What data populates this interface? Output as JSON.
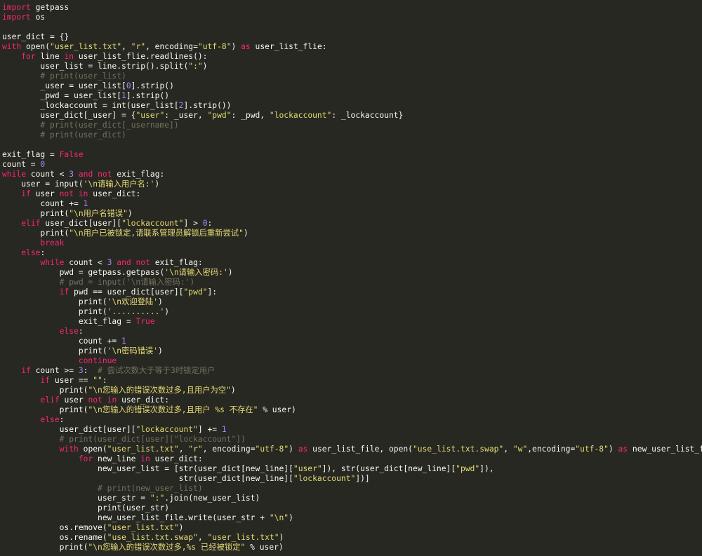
{
  "colors": {
    "background": "#272822",
    "plain": "#f8f8f2",
    "keyword": "#f92672",
    "string": "#e6db74",
    "number": "#ae81ff",
    "comment": "#75715e"
  },
  "editor": {
    "language": "python",
    "lines": [
      [
        [
          "k",
          "import"
        ],
        [
          "p",
          " getpass"
        ]
      ],
      [
        [
          "k",
          "import"
        ],
        [
          "p",
          " os"
        ]
      ],
      [],
      [
        [
          "p",
          "user_dict = {}"
        ]
      ],
      [
        [
          "k",
          "with"
        ],
        [
          "p",
          " open("
        ],
        [
          "s",
          "\"user_list.txt\""
        ],
        [
          "p",
          ", "
        ],
        [
          "s",
          "\"r\""
        ],
        [
          "p",
          ", encoding="
        ],
        [
          "s",
          "\"utf-8\""
        ],
        [
          "p",
          ") "
        ],
        [
          "k",
          "as"
        ],
        [
          "p",
          " user_list_flie:"
        ]
      ],
      [
        [
          "p",
          "    "
        ],
        [
          "k",
          "for"
        ],
        [
          "p",
          " line "
        ],
        [
          "k",
          "in"
        ],
        [
          "p",
          " user_list_flie.readlines():"
        ]
      ],
      [
        [
          "p",
          "        user_list = line.strip().split("
        ],
        [
          "s",
          "\":\""
        ],
        [
          "p",
          ")"
        ]
      ],
      [
        [
          "c",
          "        # print(user_list)"
        ]
      ],
      [
        [
          "p",
          "        _user = user_list["
        ],
        [
          "n",
          "0"
        ],
        [
          "p",
          "].strip()"
        ]
      ],
      [
        [
          "p",
          "        _pwd = user_list["
        ],
        [
          "n",
          "1"
        ],
        [
          "p",
          "].strip()"
        ]
      ],
      [
        [
          "p",
          "        _lockaccount = int(user_list["
        ],
        [
          "n",
          "2"
        ],
        [
          "p",
          "].strip())"
        ]
      ],
      [
        [
          "p",
          "        user_dict[_user] = {"
        ],
        [
          "s",
          "\"user\""
        ],
        [
          "p",
          ": _user, "
        ],
        [
          "s",
          "\"pwd\""
        ],
        [
          "p",
          ": _pwd, "
        ],
        [
          "s",
          "\"lockaccount\""
        ],
        [
          "p",
          ": _lockaccount}"
        ]
      ],
      [
        [
          "c",
          "        # print(user_dict[_username])"
        ]
      ],
      [
        [
          "c",
          "        # print(user_dict)"
        ]
      ],
      [],
      [
        [
          "p",
          "exit_flag = "
        ],
        [
          "k",
          "False"
        ]
      ],
      [
        [
          "p",
          "count = "
        ],
        [
          "n",
          "0"
        ]
      ],
      [
        [
          "k",
          "while"
        ],
        [
          "p",
          " count < "
        ],
        [
          "n",
          "3"
        ],
        [
          "p",
          " "
        ],
        [
          "k",
          "and"
        ],
        [
          "p",
          " "
        ],
        [
          "k",
          "not"
        ],
        [
          "p",
          " exit_flag:"
        ]
      ],
      [
        [
          "p",
          "    user = input("
        ],
        [
          "s",
          "'\\n请输入用户名:'"
        ],
        [
          "p",
          ")"
        ]
      ],
      [
        [
          "p",
          "    "
        ],
        [
          "k",
          "if"
        ],
        [
          "p",
          " user "
        ],
        [
          "k",
          "not"
        ],
        [
          "p",
          " "
        ],
        [
          "k",
          "in"
        ],
        [
          "p",
          " user_dict:"
        ]
      ],
      [
        [
          "p",
          "        count += "
        ],
        [
          "n",
          "1"
        ]
      ],
      [
        [
          "p",
          "        print("
        ],
        [
          "s",
          "\"\\n用户名错误\""
        ],
        [
          "p",
          ")"
        ]
      ],
      [
        [
          "p",
          "    "
        ],
        [
          "k",
          "elif"
        ],
        [
          "p",
          " user_dict[user]["
        ],
        [
          "s",
          "\"lockaccount\""
        ],
        [
          "p",
          "] > "
        ],
        [
          "n",
          "0"
        ],
        [
          "p",
          ":"
        ]
      ],
      [
        [
          "p",
          "        print("
        ],
        [
          "s",
          "\"\\n用户已被锁定,请联系管理员解锁后重新尝试\""
        ],
        [
          "p",
          ")"
        ]
      ],
      [
        [
          "p",
          "        "
        ],
        [
          "k",
          "break"
        ]
      ],
      [
        [
          "p",
          "    "
        ],
        [
          "k",
          "else"
        ],
        [
          "p",
          ":"
        ]
      ],
      [
        [
          "p",
          "        "
        ],
        [
          "k",
          "while"
        ],
        [
          "p",
          " count < "
        ],
        [
          "n",
          "3"
        ],
        [
          "p",
          " "
        ],
        [
          "k",
          "and"
        ],
        [
          "p",
          " "
        ],
        [
          "k",
          "not"
        ],
        [
          "p",
          " exit_flag:"
        ]
      ],
      [
        [
          "p",
          "            pwd = getpass.getpass("
        ],
        [
          "s",
          "'\\n请输入密码:'"
        ],
        [
          "p",
          ")"
        ]
      ],
      [
        [
          "c",
          "            # pwd = input('\\n请输入密码:')"
        ]
      ],
      [
        [
          "p",
          "            "
        ],
        [
          "k",
          "if"
        ],
        [
          "p",
          " pwd == user_dict[user]["
        ],
        [
          "s",
          "\"pwd\""
        ],
        [
          "p",
          "]:"
        ]
      ],
      [
        [
          "p",
          "                print("
        ],
        [
          "s",
          "'\\n欢迎登陆'"
        ],
        [
          "p",
          ")"
        ]
      ],
      [
        [
          "p",
          "                print("
        ],
        [
          "s",
          "'..........'"
        ],
        [
          "p",
          ")"
        ]
      ],
      [
        [
          "p",
          "                exit_flag = "
        ],
        [
          "k",
          "True"
        ]
      ],
      [
        [
          "p",
          "            "
        ],
        [
          "k",
          "else"
        ],
        [
          "p",
          ":"
        ]
      ],
      [
        [
          "p",
          "                count += "
        ],
        [
          "n",
          "1"
        ]
      ],
      [
        [
          "p",
          "                print("
        ],
        [
          "s",
          "'\\n密码错误'"
        ],
        [
          "p",
          ")"
        ]
      ],
      [
        [
          "p",
          "                "
        ],
        [
          "k",
          "continue"
        ]
      ],
      [
        [
          "p",
          "    "
        ],
        [
          "k",
          "if"
        ],
        [
          "p",
          " count >= "
        ],
        [
          "n",
          "3"
        ],
        [
          "p",
          ":  "
        ],
        [
          "c",
          "# 尝试次数大于等于3时锁定用户"
        ]
      ],
      [
        [
          "p",
          "        "
        ],
        [
          "k",
          "if"
        ],
        [
          "p",
          " user == "
        ],
        [
          "s",
          "\"\""
        ],
        [
          "p",
          ":"
        ]
      ],
      [
        [
          "p",
          "            print("
        ],
        [
          "s",
          "\"\\n您输入的错误次数过多,且用户为空\""
        ],
        [
          "p",
          ")"
        ]
      ],
      [
        [
          "p",
          "        "
        ],
        [
          "k",
          "elif"
        ],
        [
          "p",
          " user "
        ],
        [
          "k",
          "not"
        ],
        [
          "p",
          " "
        ],
        [
          "k",
          "in"
        ],
        [
          "p",
          " user_dict:"
        ]
      ],
      [
        [
          "p",
          "            print("
        ],
        [
          "s",
          "\"\\n您输入的错误次数过多,且用户 %s 不存在\""
        ],
        [
          "p",
          " % user)"
        ]
      ],
      [
        [
          "p",
          "        "
        ],
        [
          "k",
          "else"
        ],
        [
          "p",
          ":"
        ]
      ],
      [
        [
          "p",
          "            user_dict[user]["
        ],
        [
          "s",
          "\"lockaccount\""
        ],
        [
          "p",
          "] += "
        ],
        [
          "n",
          "1"
        ]
      ],
      [
        [
          "c",
          "            # print(user_dict[user][\"lockaccount\"])"
        ]
      ],
      [
        [
          "p",
          "            "
        ],
        [
          "k",
          "with"
        ],
        [
          "p",
          " open("
        ],
        [
          "s",
          "\"user_list.txt\""
        ],
        [
          "p",
          ", "
        ],
        [
          "s",
          "\"r\""
        ],
        [
          "p",
          ", encoding="
        ],
        [
          "s",
          "\"utf-8\""
        ],
        [
          "p",
          ") "
        ],
        [
          "k",
          "as"
        ],
        [
          "p",
          " user_list_file, open("
        ],
        [
          "s",
          "\"use_list.txt.swap\""
        ],
        [
          "p",
          ", "
        ],
        [
          "s",
          "\"w\""
        ],
        [
          "p",
          ",encoding="
        ],
        [
          "s",
          "\"utf-8\""
        ],
        [
          "p",
          ") "
        ],
        [
          "k",
          "as"
        ],
        [
          "p",
          " new_user_list_file:"
        ]
      ],
      [
        [
          "p",
          "                "
        ],
        [
          "k",
          "for"
        ],
        [
          "p",
          " new_line "
        ],
        [
          "k",
          "in"
        ],
        [
          "p",
          " user_dict:"
        ]
      ],
      [
        [
          "p",
          "                    new_user_list = [str(user_dict[new_line]["
        ],
        [
          "s",
          "\"user\""
        ],
        [
          "p",
          "]), str(user_dict[new_line]["
        ],
        [
          "s",
          "\"pwd\""
        ],
        [
          "p",
          "]),"
        ]
      ],
      [
        [
          "p",
          "                                     str(user_dict[new_line]["
        ],
        [
          "s",
          "\"lockaccount\""
        ],
        [
          "p",
          "])]"
        ]
      ],
      [
        [
          "c",
          "                    # print(new_user_list)"
        ]
      ],
      [
        [
          "p",
          "                    user_str = "
        ],
        [
          "s",
          "\":\""
        ],
        [
          "p",
          ".join(new_user_list)"
        ]
      ],
      [
        [
          "p",
          "                    print(user_str)"
        ]
      ],
      [
        [
          "p",
          "                    new_user_list_file.write(user_str + "
        ],
        [
          "s",
          "\"\\n\""
        ],
        [
          "p",
          ")"
        ]
      ],
      [
        [
          "p",
          "            os.remove("
        ],
        [
          "s",
          "\"user_list.txt\""
        ],
        [
          "p",
          ")"
        ]
      ],
      [
        [
          "p",
          "            os.rename("
        ],
        [
          "s",
          "\"use_list.txt.swap\""
        ],
        [
          "p",
          ", "
        ],
        [
          "s",
          "\"user_list.txt\""
        ],
        [
          "p",
          ")"
        ]
      ],
      [
        [
          "p",
          "            print("
        ],
        [
          "s",
          "\"\\n您输入的错误次数过多,%s 已经被锁定\""
        ],
        [
          "p",
          " % user)"
        ]
      ]
    ]
  }
}
